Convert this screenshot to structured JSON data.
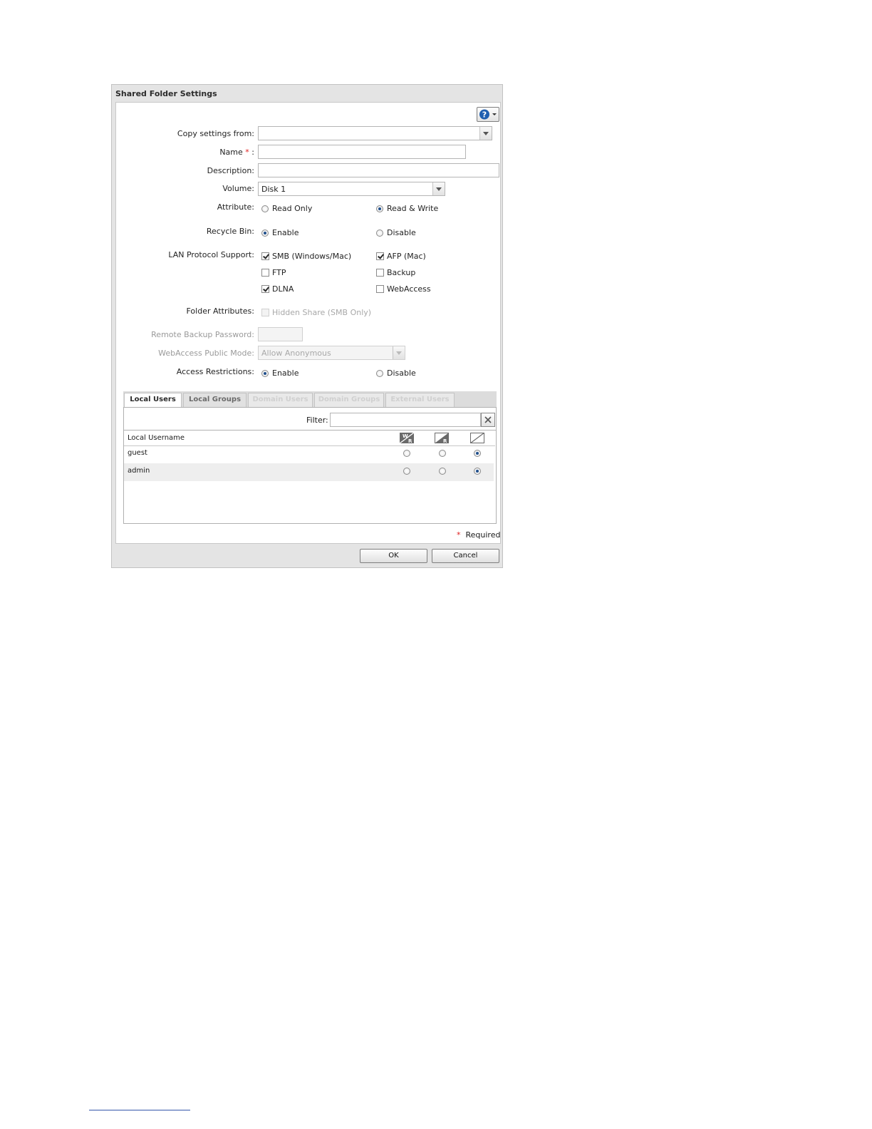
{
  "dialog": {
    "title": "Shared Folder Settings",
    "required_marker": "*",
    "required_text": "Required"
  },
  "form": {
    "copy_settings_label": "Copy settings from:",
    "copy_settings_value": "",
    "name_label": "Name",
    "name_required": "*",
    "name_colon": ":",
    "name_value": "",
    "description_label": "Description:",
    "description_value": "",
    "volume_label": "Volume:",
    "volume_value": "Disk 1",
    "attribute_label": "Attribute:",
    "attribute_options": [
      "Read Only",
      "Read & Write"
    ],
    "attribute_selected": "Read & Write",
    "recycle_label": "Recycle Bin:",
    "recycle_options": [
      "Enable",
      "Disable"
    ],
    "recycle_selected": "Enable",
    "lan_label": "LAN Protocol Support:",
    "lan_options": [
      {
        "label": "SMB (Windows/Mac)",
        "checked": true
      },
      {
        "label": "AFP (Mac)",
        "checked": true
      },
      {
        "label": "FTP",
        "checked": false
      },
      {
        "label": "Backup",
        "checked": false
      },
      {
        "label": "DLNA",
        "checked": true
      },
      {
        "label": "WebAccess",
        "checked": false
      }
    ],
    "folder_attr_label": "Folder Attributes:",
    "hidden_share_label": "Hidden Share (SMB Only)",
    "remote_backup_label": "Remote Backup Password:",
    "remote_backup_value": "",
    "webaccess_mode_label": "WebAccess Public Mode:",
    "webaccess_mode_value": "Allow Anonymous",
    "access_label": "Access Restrictions:",
    "access_options": [
      "Enable",
      "Disable"
    ],
    "access_selected": "Enable"
  },
  "tabs": [
    {
      "label": "Local Users",
      "state": "active"
    },
    {
      "label": "Local Groups",
      "state": "inactive"
    },
    {
      "label": "Domain Users",
      "state": "disabled"
    },
    {
      "label": "Domain Groups",
      "state": "disabled"
    },
    {
      "label": "External Users",
      "state": "disabled"
    }
  ],
  "filter": {
    "label": "Filter:",
    "value": ""
  },
  "table": {
    "column_username": "Local Username",
    "permission_icons": [
      "read-write-icon",
      "read-only-icon",
      "no-access-icon"
    ],
    "rows": [
      {
        "username": "guest",
        "permission": "none"
      },
      {
        "username": "admin",
        "permission": "none"
      }
    ]
  },
  "buttons": {
    "ok": "OK",
    "cancel": "Cancel"
  },
  "icons": {
    "help": "help-icon",
    "clear": "clear-icon"
  },
  "colors": {
    "accent": "#1f4f8c",
    "required": "#e02020"
  }
}
